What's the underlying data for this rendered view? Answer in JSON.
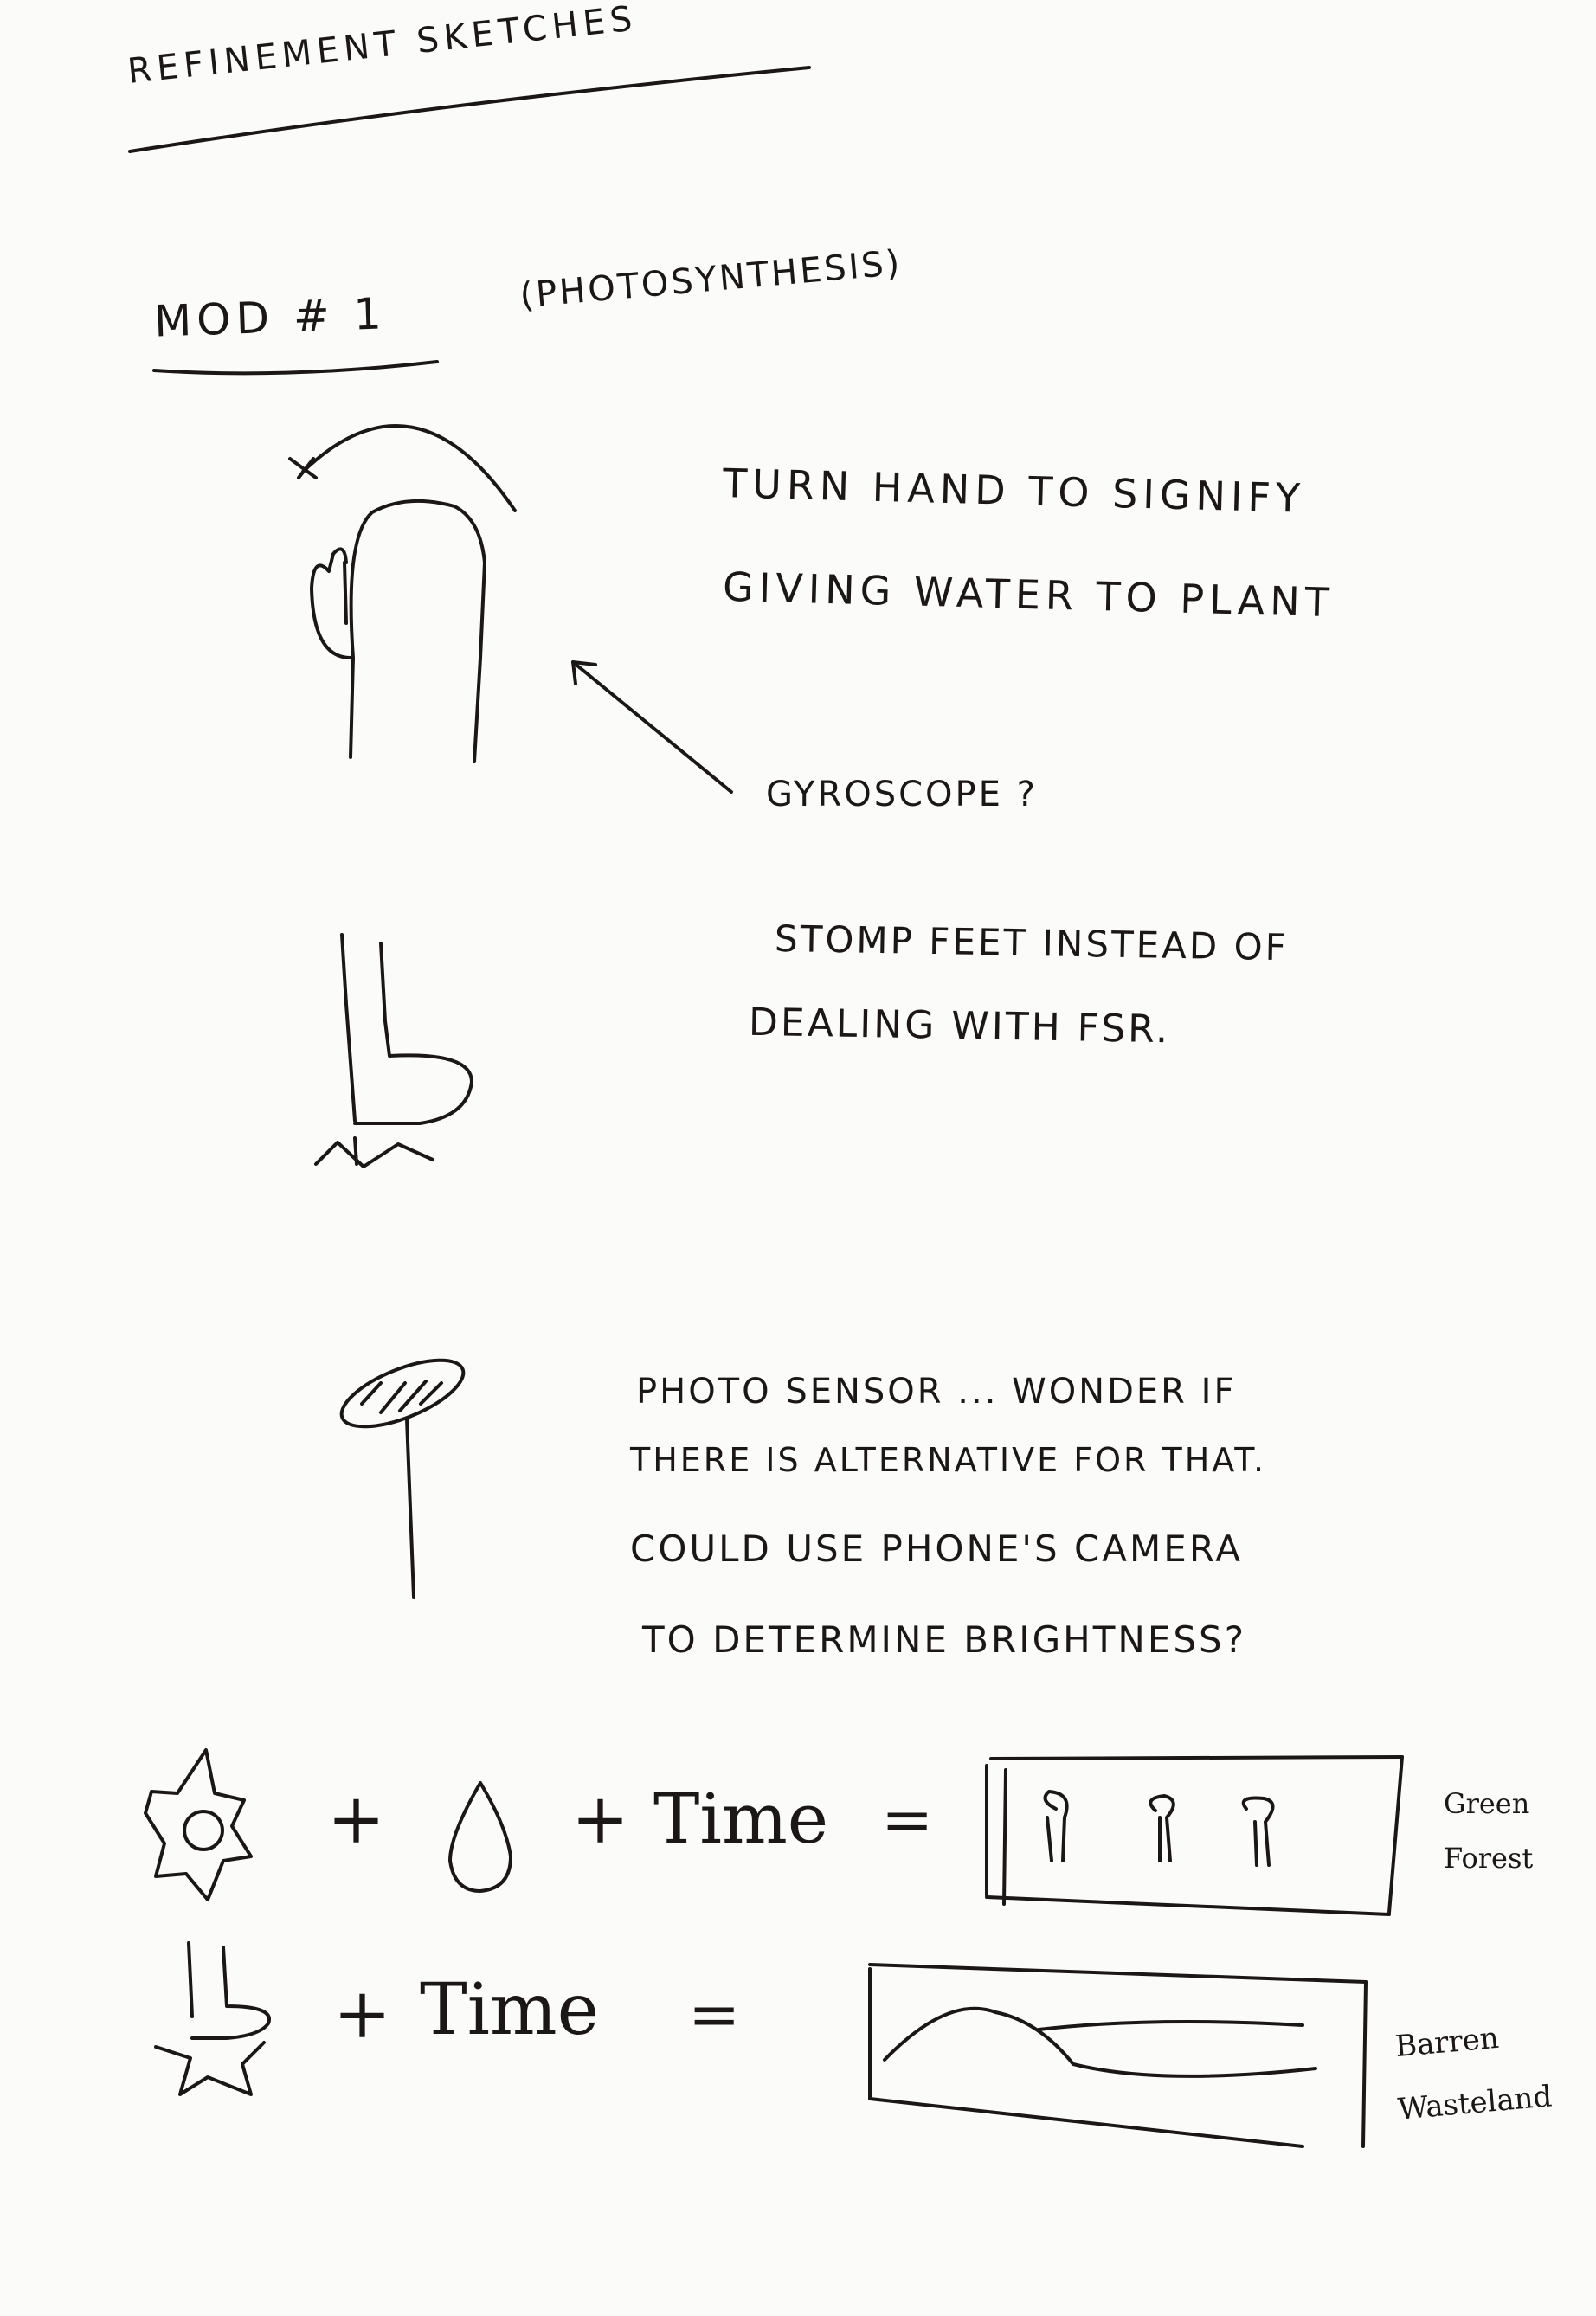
{
  "page": {
    "heading": "REFINEMENT SKETCHES",
    "section_label": "MOD # 1",
    "section_topic": "(PHOTOSYNTHESIS)"
  },
  "notes": {
    "hand_line1": "TURN HAND TO SIGNIFY",
    "hand_line2": "GIVING WATER TO PLANT",
    "gyro": "GYROSCOPE ?",
    "stomp_line1": "STOMP FEET INSTEAD OF",
    "stomp_line2": "DEALING WITH FSR.",
    "photo_line1": "PHOTO SENSOR ... WONDER IF",
    "photo_line2": "THERE IS ALTERNATIVE FOR THAT.",
    "photo_line3": "COULD USE PHONE'S CAMERA",
    "photo_line4": "TO DETERMINE BRIGHTNESS?"
  },
  "equations": {
    "row1_plus1": "+",
    "row1_plus2": "+",
    "row1_time": "Time",
    "row1_equals": "=",
    "row1_result_line1": "Green",
    "row1_result_line2": "Forest",
    "row2_plus": "+",
    "row2_time": "Time",
    "row2_equals": "=",
    "row2_result_line1": "Barren",
    "row2_result_line2": "Wasteland"
  }
}
